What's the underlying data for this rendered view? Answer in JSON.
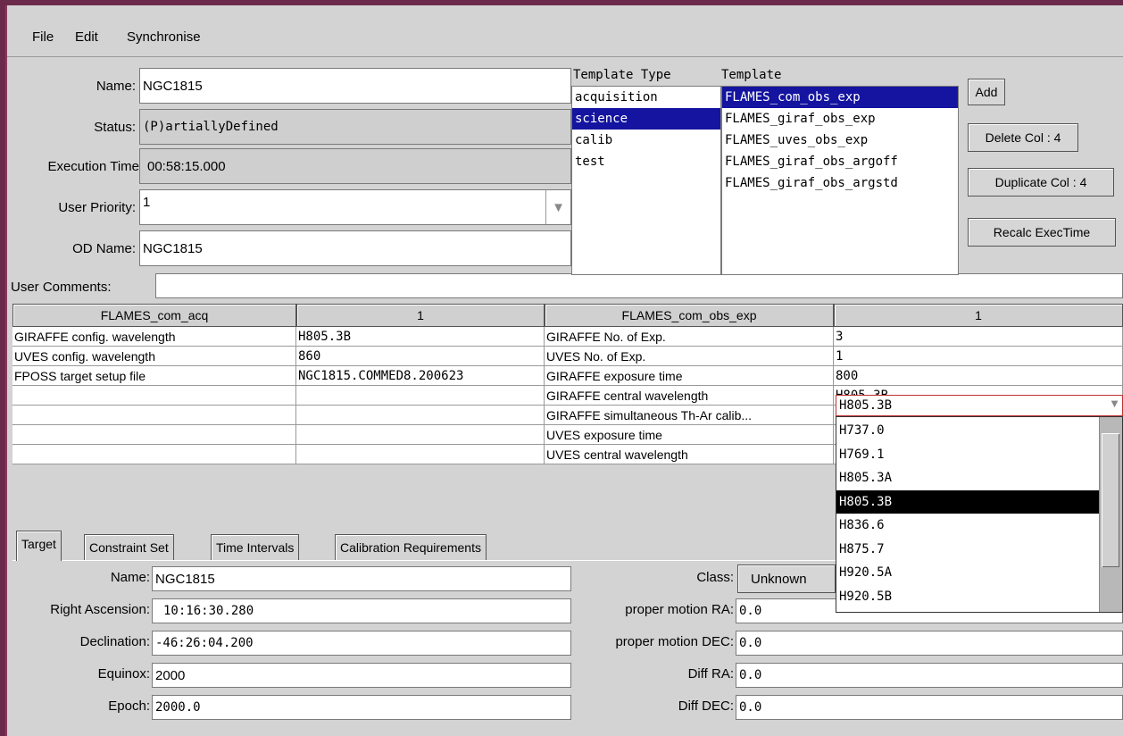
{
  "menu": [
    "File",
    "Edit",
    "Synchronise"
  ],
  "form": {
    "name_label": "Name:",
    "name_value": "NGC1815",
    "status_label": "Status:",
    "status_value": "(P)artiallyDefined",
    "exec_label": "Execution Time",
    "exec_value": "00:58:15.000",
    "priority_label": "User Priority:",
    "priority_value": "1",
    "od_label": "OD Name:",
    "od_value": "NGC1815",
    "comments_label": "User Comments:"
  },
  "template_type": {
    "title": "Template Type",
    "items": [
      "acquisition",
      "science",
      "calib",
      "test"
    ],
    "selected": "science"
  },
  "template": {
    "title": "Template",
    "items": [
      "FLAMES_com_obs_exp",
      "FLAMES_giraf_obs_exp",
      "FLAMES_uves_obs_exp",
      "FLAMES_giraf_obs_argoff",
      "FLAMES_giraf_obs_argstd"
    ],
    "selected": "FLAMES_com_obs_exp"
  },
  "buttons": {
    "add": "Add",
    "delete_col": "Delete Col : 4",
    "duplicate_col": "Duplicate Col : 4",
    "recalc": "Recalc ExecTime"
  },
  "table": {
    "headers": [
      "FLAMES_com_acq",
      "1",
      "FLAMES_com_obs_exp",
      "1"
    ],
    "rows": [
      [
        "GIRAFFE config. wavelength",
        "H805.3B",
        "GIRAFFE No. of Exp.",
        "3"
      ],
      [
        "UVES config. wavelength",
        "860",
        "UVES No. of Exp.",
        "1"
      ],
      [
        "FPOSS target setup file",
        "NGC1815.COMMED8.200623",
        "GIRAFFE exposure time",
        "800"
      ],
      [
        "",
        "",
        "GIRAFFE central wavelength",
        "H805.3B"
      ],
      [
        "",
        "",
        "GIRAFFE simultaneous Th-Ar calib...",
        ""
      ],
      [
        "",
        "",
        "UVES exposure time",
        ""
      ],
      [
        "",
        "",
        "UVES central wavelength",
        ""
      ]
    ]
  },
  "dropdown": {
    "options": [
      "H737.0",
      "H769.1",
      "H805.3A",
      "H805.3B",
      "H836.6",
      "H875.7",
      "H920.5A",
      "H920.5B"
    ],
    "selected": "H805.3B"
  },
  "tabs": [
    "Target",
    "Constraint Set",
    "Time Intervals",
    "Calibration Requirements"
  ],
  "target": {
    "name_label": "Name:",
    "name_value": "NGC1815",
    "ra_label": "Right Ascension:",
    "ra_value": "10:16:30.280",
    "dec_label": "Declination:",
    "dec_value": "-46:26:04.200",
    "equinox_label": "Equinox:",
    "equinox_value": "2000",
    "epoch_label": "Epoch:",
    "epoch_value": "2000.0",
    "class_label": "Class:",
    "class_value": "Unknown",
    "pmra_label": "proper motion RA:",
    "pmra_value": "0.0",
    "pmdec_label": "proper motion DEC:",
    "pmdec_value": "0.0",
    "diffra_label": "Diff RA:",
    "diffra_value": "0.0",
    "diffdec_label": "Diff DEC:",
    "diffdec_value": "0.0"
  }
}
